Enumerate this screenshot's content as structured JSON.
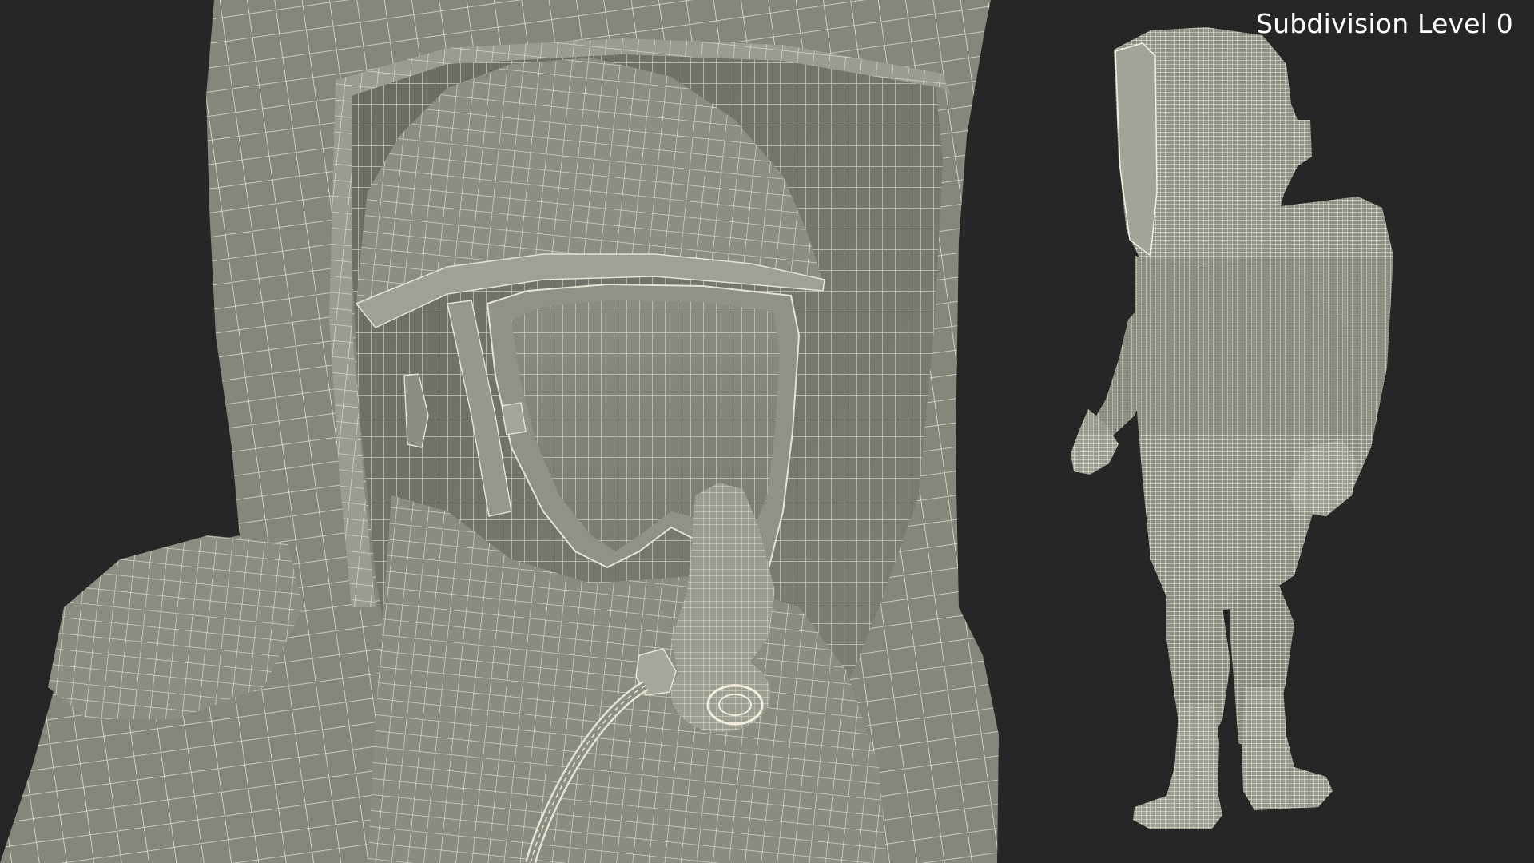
{
  "viewport": {
    "background_color": "#262626",
    "mesh_fill_color": "#85877a",
    "mesh_shadow_color": "#5c5e54",
    "wire_color": "#e6e3d3",
    "label_color": "#ffffff"
  },
  "overlay": {
    "subdivision_label": "Subdivision Level 0"
  },
  "scene": {
    "closeup_subject": "hazmat-suit-hood-closeup",
    "full_figure_subject": "hazmat-suit-full-figure"
  }
}
